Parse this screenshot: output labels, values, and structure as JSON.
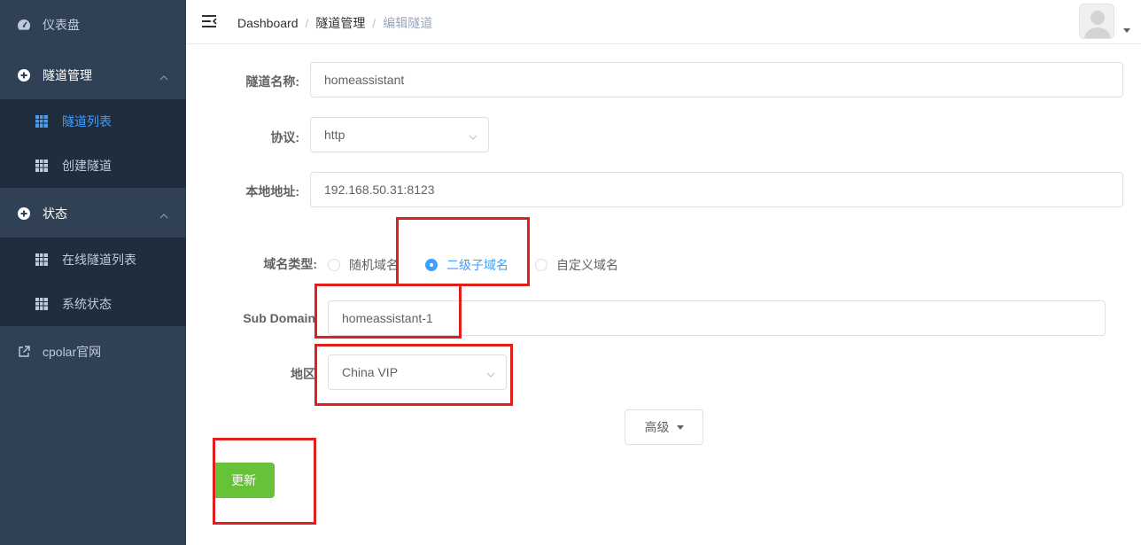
{
  "sidebar": {
    "dashboard": {
      "label": "仪表盘",
      "icon": "dashboard-icon"
    },
    "tunnel_mgmt": {
      "label": "隧道管理",
      "icon": "plus-circle-icon"
    },
    "tunnel_list": {
      "label": "隧道列表",
      "icon": "table-icon"
    },
    "create_tunnel": {
      "label": "创建隧道",
      "icon": "table-icon"
    },
    "status": {
      "label": "状态",
      "icon": "plus-circle-icon"
    },
    "online_tunnels": {
      "label": "在线隧道列表",
      "icon": "table-icon"
    },
    "system_status": {
      "label": "系统状态",
      "icon": "table-icon"
    },
    "cpolar_site": {
      "label": "cpolar官网",
      "icon": "external-link-icon"
    }
  },
  "header": {
    "breadcrumb": [
      "Dashboard",
      "隧道管理",
      "编辑隧道"
    ]
  },
  "form": {
    "name": {
      "label": "隧道名称:",
      "value": "homeassistant"
    },
    "protocol": {
      "label": "协议:",
      "value": "http"
    },
    "local_addr": {
      "label": "本地地址:",
      "value": "192.168.50.31:8123"
    },
    "domain_type": {
      "label": "域名类型:",
      "options": [
        "随机域名",
        "二级子域名",
        "自定义域名"
      ],
      "selected": "二级子域名"
    },
    "sub_domain": {
      "label": "Sub Domain",
      "value": "homeassistant-1"
    },
    "region": {
      "label": "地区",
      "value": "China VIP"
    },
    "advanced_label": "高级",
    "update_label": "更新"
  },
  "colors": {
    "sidebar_bg": "#304156",
    "submenu_bg": "#1f2d3d",
    "accent": "#409eff",
    "success": "#67c23a",
    "highlight": "#e0201f"
  }
}
